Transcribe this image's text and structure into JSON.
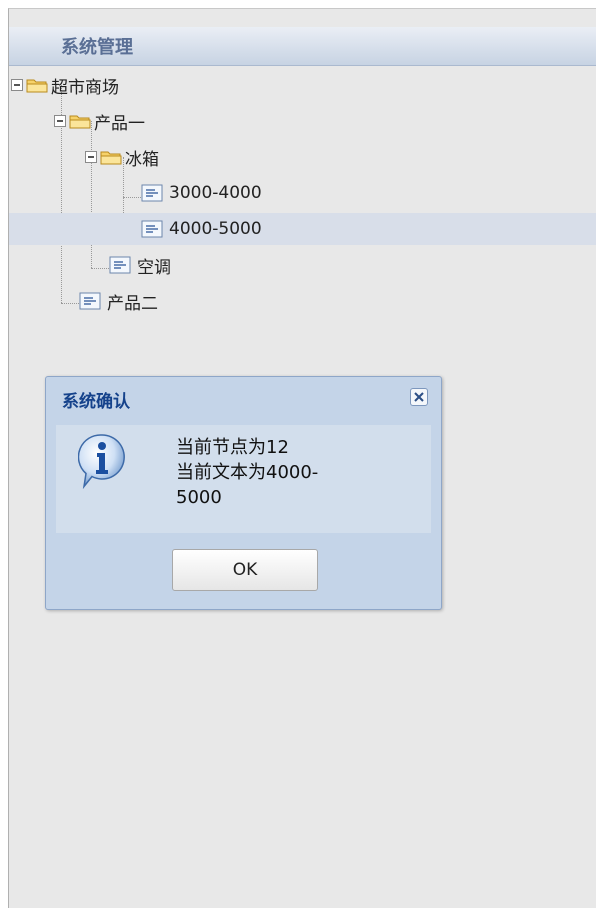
{
  "panel": {
    "title": "系统管理"
  },
  "tree": {
    "root": {
      "label": "超市商场",
      "icon": "folder-open-icon"
    },
    "product1": {
      "label": "产品一",
      "icon": "folder-open-icon"
    },
    "fridge": {
      "label": "冰箱",
      "icon": "folder-open-icon"
    },
    "range1": {
      "label": "3000-4000",
      "icon": "leaf-node-icon"
    },
    "range2": {
      "label": "4000-5000",
      "icon": "leaf-node-icon",
      "selected": true
    },
    "aircon": {
      "label": "空调",
      "icon": "leaf-node-icon"
    },
    "product2": {
      "label": "产品二",
      "icon": "leaf-node-icon"
    }
  },
  "dialog": {
    "title": "系统确认",
    "message_lines": [
      "当前节点为12",
      "当前文本为4000-",
      "5000"
    ],
    "ok_label": "OK",
    "icon": "info-icon",
    "close_icon": "close-icon"
  },
  "colors": {
    "header_title": "#5a6f95",
    "dialog_title": "#15428b",
    "dialog_bg": "#c4d4e8",
    "selected_row": "#d8dee9"
  }
}
